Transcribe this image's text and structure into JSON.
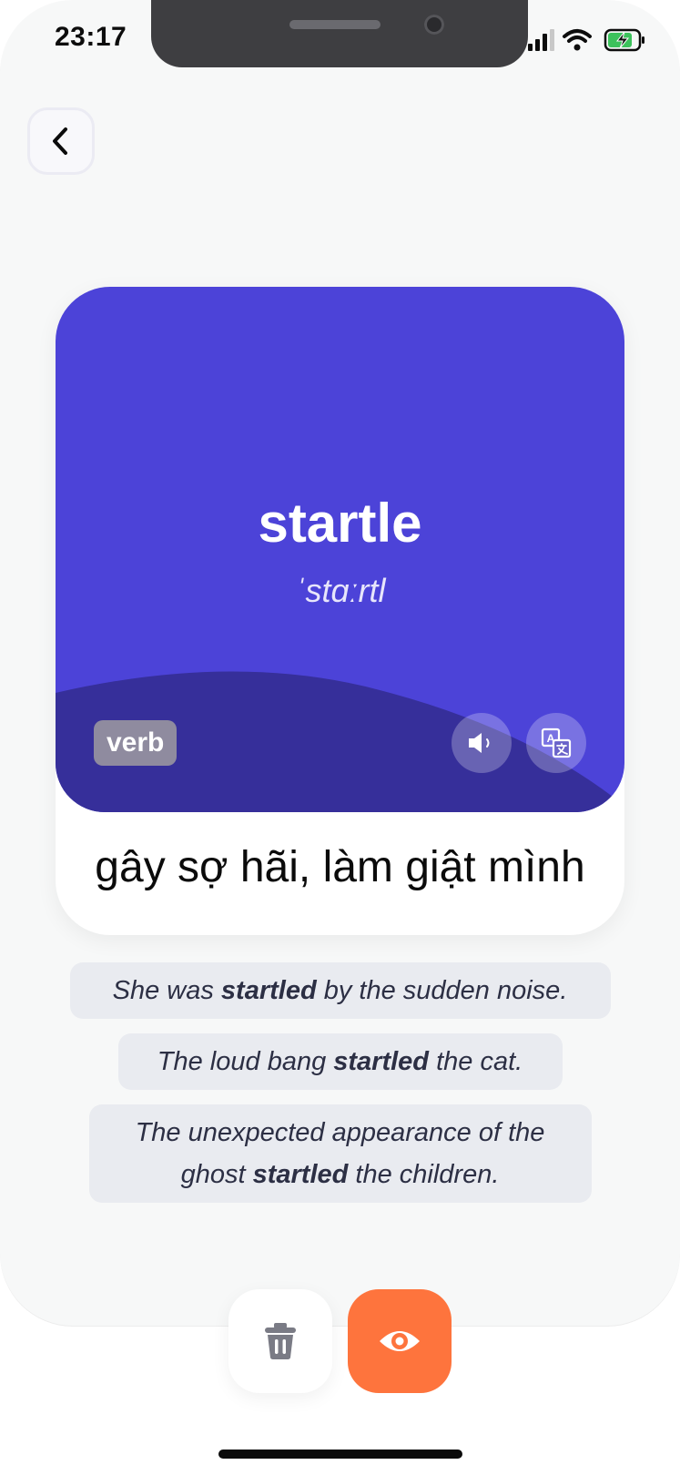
{
  "status_bar": {
    "time": "23:17",
    "icons": [
      "signal-icon",
      "wifi-icon",
      "battery-charging-icon"
    ]
  },
  "navigation": {
    "back_icon": "chevron-left-icon"
  },
  "flashcard": {
    "word": "startle",
    "phonetic": "ˈstɑːrtl",
    "part_of_speech": "verb",
    "meaning": "gây sợ hãi, làm giật mình",
    "sound_icon": "speaker-icon",
    "translate_icon": "translate-icon",
    "colors": {
      "card_top": "#4c43d8",
      "card_wave": "#362f9a"
    }
  },
  "examples": [
    {
      "before": "She was ",
      "bold": "startled",
      "after": " by the sudden noise."
    },
    {
      "before": "The loud bang ",
      "bold": "startled",
      "after": " the cat."
    },
    {
      "before": "The unexpected appearance of the ghost ",
      "bold": "startled",
      "after": " the children."
    }
  ],
  "actions": {
    "delete_icon": "trash-icon",
    "reveal_icon": "eye-icon",
    "colors": {
      "reveal": "#fe743d",
      "delete_icon": "#7a7b85"
    }
  }
}
